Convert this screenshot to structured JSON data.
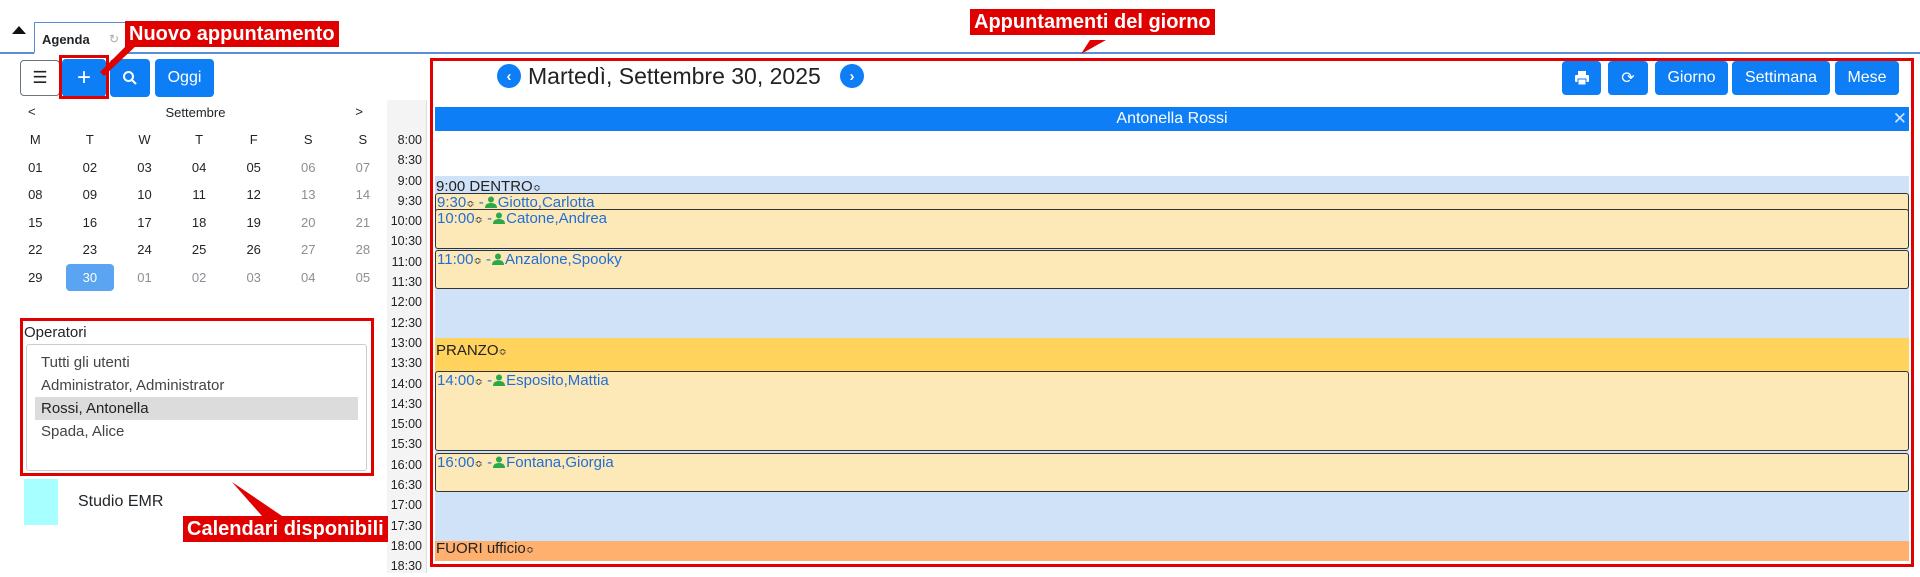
{
  "tab": {
    "label": "Agenda"
  },
  "toolbar": {
    "today_label": "Oggi"
  },
  "annotations": {
    "new_appointment": "Nuovo appuntamento",
    "day_appointments": "Appuntamenti del giorno",
    "available_calendars": "Calendari disponibili"
  },
  "mini_calendar": {
    "prev": "<",
    "next": ">",
    "month": "Settembre",
    "weekdays": [
      "M",
      "T",
      "W",
      "T",
      "F",
      "S",
      "S"
    ],
    "weeks": [
      [
        "01",
        "02",
        "03",
        "04",
        "05",
        "06",
        "07"
      ],
      [
        "08",
        "09",
        "10",
        "11",
        "12",
        "13",
        "14"
      ],
      [
        "15",
        "16",
        "17",
        "18",
        "19",
        "20",
        "21"
      ],
      [
        "22",
        "23",
        "24",
        "25",
        "26",
        "27",
        "28"
      ],
      [
        "29",
        "30",
        "01",
        "02",
        "03",
        "04",
        "05"
      ]
    ],
    "selected": "30"
  },
  "operators": {
    "title": "Operatori",
    "items": [
      "Tutti gli utenti",
      "Administrator, Administrator",
      "Rossi, Antonella",
      "Spada, Alice"
    ],
    "selected_index": 2
  },
  "studio": {
    "label": "Studio EMR",
    "color": "#a8ffff"
  },
  "header": {
    "date_title": "Martedì, Settembre 30, 2025"
  },
  "view_buttons": {
    "day": "Giorno",
    "week": "Settimana",
    "month": "Mese"
  },
  "times": [
    "8:00",
    "8:30",
    "9:00",
    "9:30",
    "10:00",
    "10:30",
    "11:00",
    "11:30",
    "12:00",
    "12:30",
    "13:00",
    "13:30",
    "14:00",
    "14:30",
    "15:00",
    "15:30",
    "16:00",
    "16:30",
    "17:00",
    "17:30",
    "18:00",
    "18:30"
  ],
  "schedule": {
    "person": "Antonella Rossi",
    "events": [
      {
        "kind": "block",
        "label": "9:00 DENTRO"
      },
      {
        "kind": "appt",
        "time": "9:30",
        "patient": "Giotto,Carlotta"
      },
      {
        "kind": "appt",
        "time": "10:00",
        "patient": "Catone,Andrea"
      },
      {
        "kind": "appt",
        "time": "11:00",
        "patient": "Anzalone,Spooky"
      },
      {
        "kind": "block",
        "label": "PRANZO"
      },
      {
        "kind": "appt",
        "time": "14:00",
        "patient": "Esposito,Mattia"
      },
      {
        "kind": "appt",
        "time": "16:00",
        "patient": "Fontana,Giorgia"
      },
      {
        "kind": "block",
        "label": "FUORI ufficio"
      }
    ],
    "colors": {
      "in_office": "#cfe2f8",
      "lunch": "#ffd35c",
      "out_office": "#ffb06e",
      "appointment": "#fde8b8",
      "accent": "#0d7ef5",
      "annotation": "#e00000"
    }
  }
}
